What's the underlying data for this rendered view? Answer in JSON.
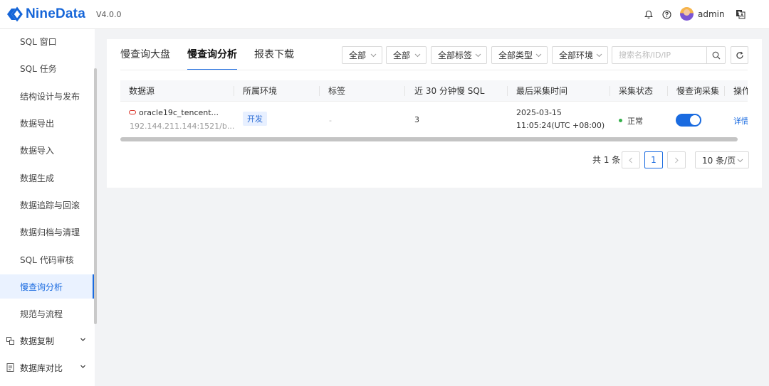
{
  "app": {
    "name": "NineData",
    "version": "V4.0.0"
  },
  "header": {
    "user": "admin"
  },
  "sidebar": {
    "items": [
      {
        "label": "SQL 窗口"
      },
      {
        "label": "SQL 任务"
      },
      {
        "label": "结构设计与发布"
      },
      {
        "label": "数据导出"
      },
      {
        "label": "数据导入"
      },
      {
        "label": "数据生成"
      },
      {
        "label": "数据追踪与回滚"
      },
      {
        "label": "数据归档与清理"
      },
      {
        "label": "SQL 代码审核"
      },
      {
        "label": "慢查询分析",
        "active": true
      },
      {
        "label": "规范与流程"
      }
    ],
    "groups": [
      {
        "label": "数据复制",
        "icon": "replication-icon"
      },
      {
        "label": "数据库对比",
        "icon": "compare-icon"
      }
    ]
  },
  "tabs": [
    {
      "label": "慢查询大盘"
    },
    {
      "label": "慢查询分析",
      "active": true
    },
    {
      "label": "报表下载"
    }
  ],
  "filters": [
    {
      "value": "全部"
    },
    {
      "value": "全部"
    },
    {
      "value": "全部标签"
    },
    {
      "value": "全部类型"
    },
    {
      "value": "全部环境"
    }
  ],
  "search": {
    "placeholder": "搜索名称/ID/IP"
  },
  "table": {
    "columns": [
      "数据源",
      "所属环境",
      "标签",
      "近 30 分钟慢 SQL",
      "最后采集时间",
      "采集状态",
      "慢查询采集",
      "操作"
    ],
    "rows": [
      {
        "datasource": "oracle19c_tencent...",
        "address": "192.144.211.144:1521/b...",
        "env": "开发",
        "tag": "-",
        "slow_sql_30min": "3",
        "last_time_date": "2025-03-15",
        "last_time_clock": "11:05:24(UTC +08:00)",
        "status": "正常",
        "collect_enabled": true,
        "action": "详情"
      }
    ]
  },
  "pagination": {
    "total_text": "共 1 条",
    "current_page": "1",
    "page_size": "10 条/页"
  },
  "colors": {
    "accent": "#1a6be0",
    "status_ok": "#36b14c",
    "oracle": "#d93026"
  }
}
